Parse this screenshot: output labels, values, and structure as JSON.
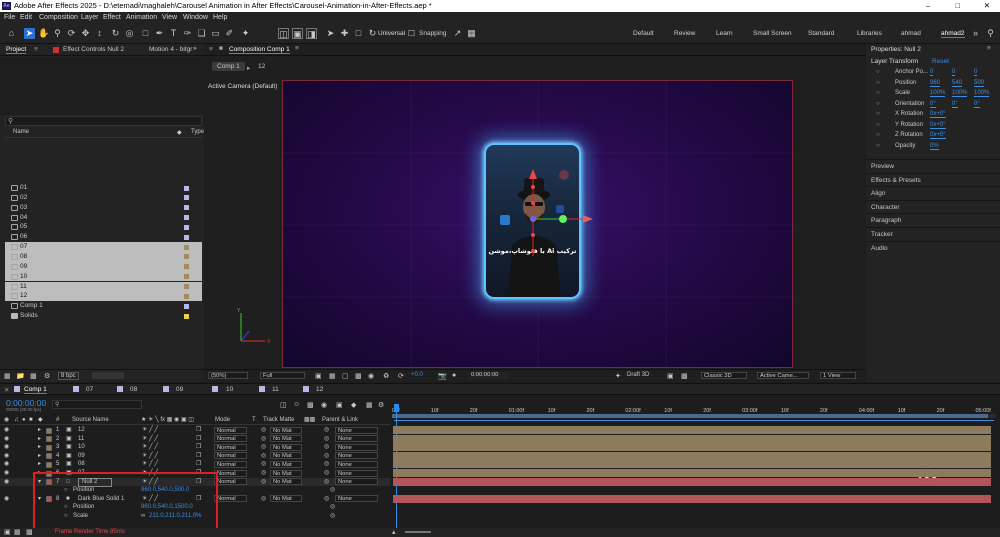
{
  "window": {
    "title": "Adobe After Effects 2025 - D:\\etemadi\\maghaleh\\Carousel Animation in After Effects\\Carousel-Animation-in-After-Effects.aep *",
    "app_icon": "Ae"
  },
  "menu": [
    "File",
    "Edit",
    "Composition",
    "Layer",
    "Effect",
    "Animation",
    "View",
    "Window",
    "Help"
  ],
  "toolbar": {
    "universal": "Universal",
    "snapping": "Snapping"
  },
  "workspaces": [
    "Default",
    "Review",
    "Learn",
    "Small Screen",
    "Standard",
    "Libraries",
    "ahmad",
    "ahmad2"
  ],
  "project_panel": {
    "tab_project": "Project",
    "tab_effect": "Effect Controls Null 2",
    "tab_motion": "Motion 4 - bitgr",
    "search_placeholder": "",
    "col_name": "Name",
    "col_type": "Type",
    "items": [
      {
        "name": "01",
        "selected": false,
        "label_color": "#b9b9e6"
      },
      {
        "name": "02",
        "selected": false,
        "label_color": "#b9b9e6"
      },
      {
        "name": "03",
        "selected": false,
        "label_color": "#b9b9e6"
      },
      {
        "name": "04",
        "selected": false,
        "label_color": "#b9b9e6"
      },
      {
        "name": "05",
        "selected": false,
        "label_color": "#b9b9e6"
      },
      {
        "name": "06",
        "selected": false,
        "label_color": "#b9b9e6"
      },
      {
        "name": "07",
        "selected": true,
        "label_color": "#a48a5c"
      },
      {
        "name": "08",
        "selected": true,
        "label_color": "#a48a5c"
      },
      {
        "name": "09",
        "selected": true,
        "label_color": "#a48a5c"
      },
      {
        "name": "10",
        "selected": true,
        "label_color": "#a48a5c"
      },
      {
        "name": "11",
        "selected": true,
        "label_color": "#a48a5c"
      },
      {
        "name": "12",
        "selected": true,
        "label_color": "#a48a5c"
      },
      {
        "name": "Comp 1",
        "selected": false,
        "label_color": "#b9b9e6"
      },
      {
        "name": "Solids",
        "selected": false,
        "label_color": "#e8d34a"
      }
    ],
    "bpc": "8 bpc"
  },
  "composition_panel": {
    "tab": "Composition Comp 1",
    "comp_tab": "Comp 1",
    "comp_tab2": "12",
    "camera": "Active Camera (Default)",
    "card_text": "ترکیب Ai با فتوشاپ،موشن",
    "zoom": "(50%)",
    "resolution": "Full",
    "exposure": "+0.0",
    "timecode": "0:00:00:00",
    "renderer": "Draft 3D",
    "view_renderer": "Classic 3D",
    "active_camera": "Active Came...",
    "views": "1 View"
  },
  "properties_panel": {
    "title": "Properties: Null 2",
    "section": "Layer Transform",
    "reset": "Reset",
    "rows": [
      {
        "label": "Anchor Po...",
        "values": [
          "0",
          "0",
          "0"
        ]
      },
      {
        "label": "Position",
        "values": [
          "960",
          "540",
          "500"
        ]
      },
      {
        "label": "Scale",
        "values": [
          "100%",
          "100%",
          "100%"
        ]
      },
      {
        "label": "Orientation",
        "values": [
          "0°",
          "0°",
          "0°"
        ]
      },
      {
        "label": "X Rotation",
        "values": [
          "0x+0°"
        ]
      },
      {
        "label": "Y Rotation",
        "values": [
          "0x+0°"
        ]
      },
      {
        "label": "Z Rotation",
        "values": [
          "0x+0°"
        ]
      },
      {
        "label": "Opacity",
        "values": [
          "0%"
        ]
      }
    ],
    "collapsed_panels": [
      "Preview",
      "Effects & Presets",
      "Align",
      "Character",
      "Paragraph",
      "Tracker",
      "Audio"
    ]
  },
  "timeline": {
    "tabs": [
      "Comp 1",
      "07",
      "08",
      "09",
      "10",
      "11",
      "12"
    ],
    "timecode": "0:00:00:00",
    "timecode_sub": "00000 (30.00 fps)",
    "col_source": "Source Name",
    "col_mode": "Mode",
    "col_t": "T",
    "col_track": "Track Matte",
    "col_parent": "Parent & Link",
    "ruler": [
      "00f",
      "10f",
      "20f",
      "01:00f",
      "10f",
      "20f",
      "02:00f",
      "10f",
      "20f",
      "03:00f",
      "10f",
      "20f",
      "04:00f",
      "10f",
      "20f",
      "05:00f"
    ],
    "layers": [
      {
        "num": "1",
        "name": "12",
        "mode": "Normal",
        "matte": "No Mat",
        "parent": "None",
        "type": "comp"
      },
      {
        "num": "2",
        "name": "11",
        "mode": "Normal",
        "matte": "No Mat",
        "parent": "None",
        "type": "comp"
      },
      {
        "num": "3",
        "name": "10",
        "mode": "Normal",
        "matte": "No Mat",
        "parent": "None",
        "type": "comp"
      },
      {
        "num": "4",
        "name": "09",
        "mode": "Normal",
        "matte": "No Mat",
        "parent": "None",
        "type": "comp"
      },
      {
        "num": "5",
        "name": "08",
        "mode": "Normal",
        "matte": "No Mat",
        "parent": "None",
        "type": "comp"
      },
      {
        "num": "6",
        "name": "07",
        "mode": "Normal",
        "matte": "No Mat",
        "parent": "None",
        "type": "comp"
      },
      {
        "num": "7",
        "name": "Null 2",
        "mode": "Normal",
        "matte": "No Mat",
        "parent": "None",
        "type": "null"
      },
      {
        "num": "8",
        "name": "Dark Blue Solid 1",
        "mode": "Normal",
        "matte": "No Mat",
        "parent": "None",
        "type": "solid"
      }
    ],
    "null_position_label": "Position",
    "null_position_value": "960.0,540.0,500.0",
    "solid_position_label": "Position",
    "solid_position_value": "960.0,540.0,1500.0",
    "solid_scale_label": "Scale",
    "solid_scale_value": "211.0,211.0,211.0%",
    "footer": "Frame Render Time 85ms"
  },
  "watermark": "/b",
  "colors": {
    "accent_blue": "#2d8ceb",
    "layer_tan": "#8c7b5c",
    "layer_red": "#b3565a",
    "highlight_box": "#e02020",
    "card_glow": "#3fb5ff"
  }
}
